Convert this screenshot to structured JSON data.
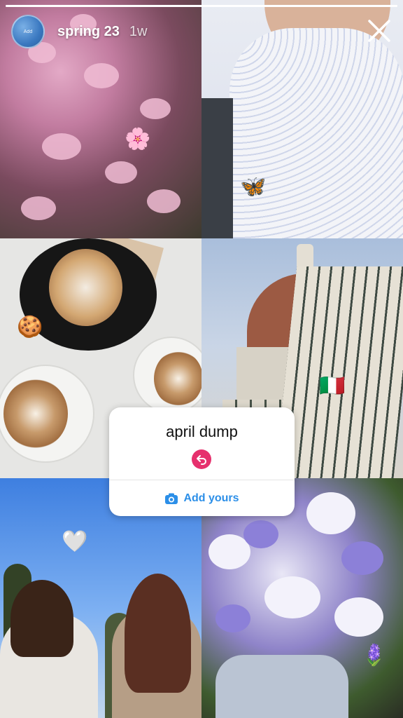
{
  "header": {
    "avatar_label": "Add",
    "username": "spring 23",
    "timestamp": "1w",
    "progress": 1.0
  },
  "close_icon": "close-icon",
  "stickers": {
    "flower": "🌸",
    "butterfly": "🦋",
    "cookie": "🍪",
    "flag": "🇮🇹",
    "heart": "🤍",
    "hyacinth": "🪻"
  },
  "add_yours": {
    "prompt": "april dump",
    "action_label": "Add yours",
    "accent": "#e6306d",
    "link_color": "#2c8fe8"
  }
}
